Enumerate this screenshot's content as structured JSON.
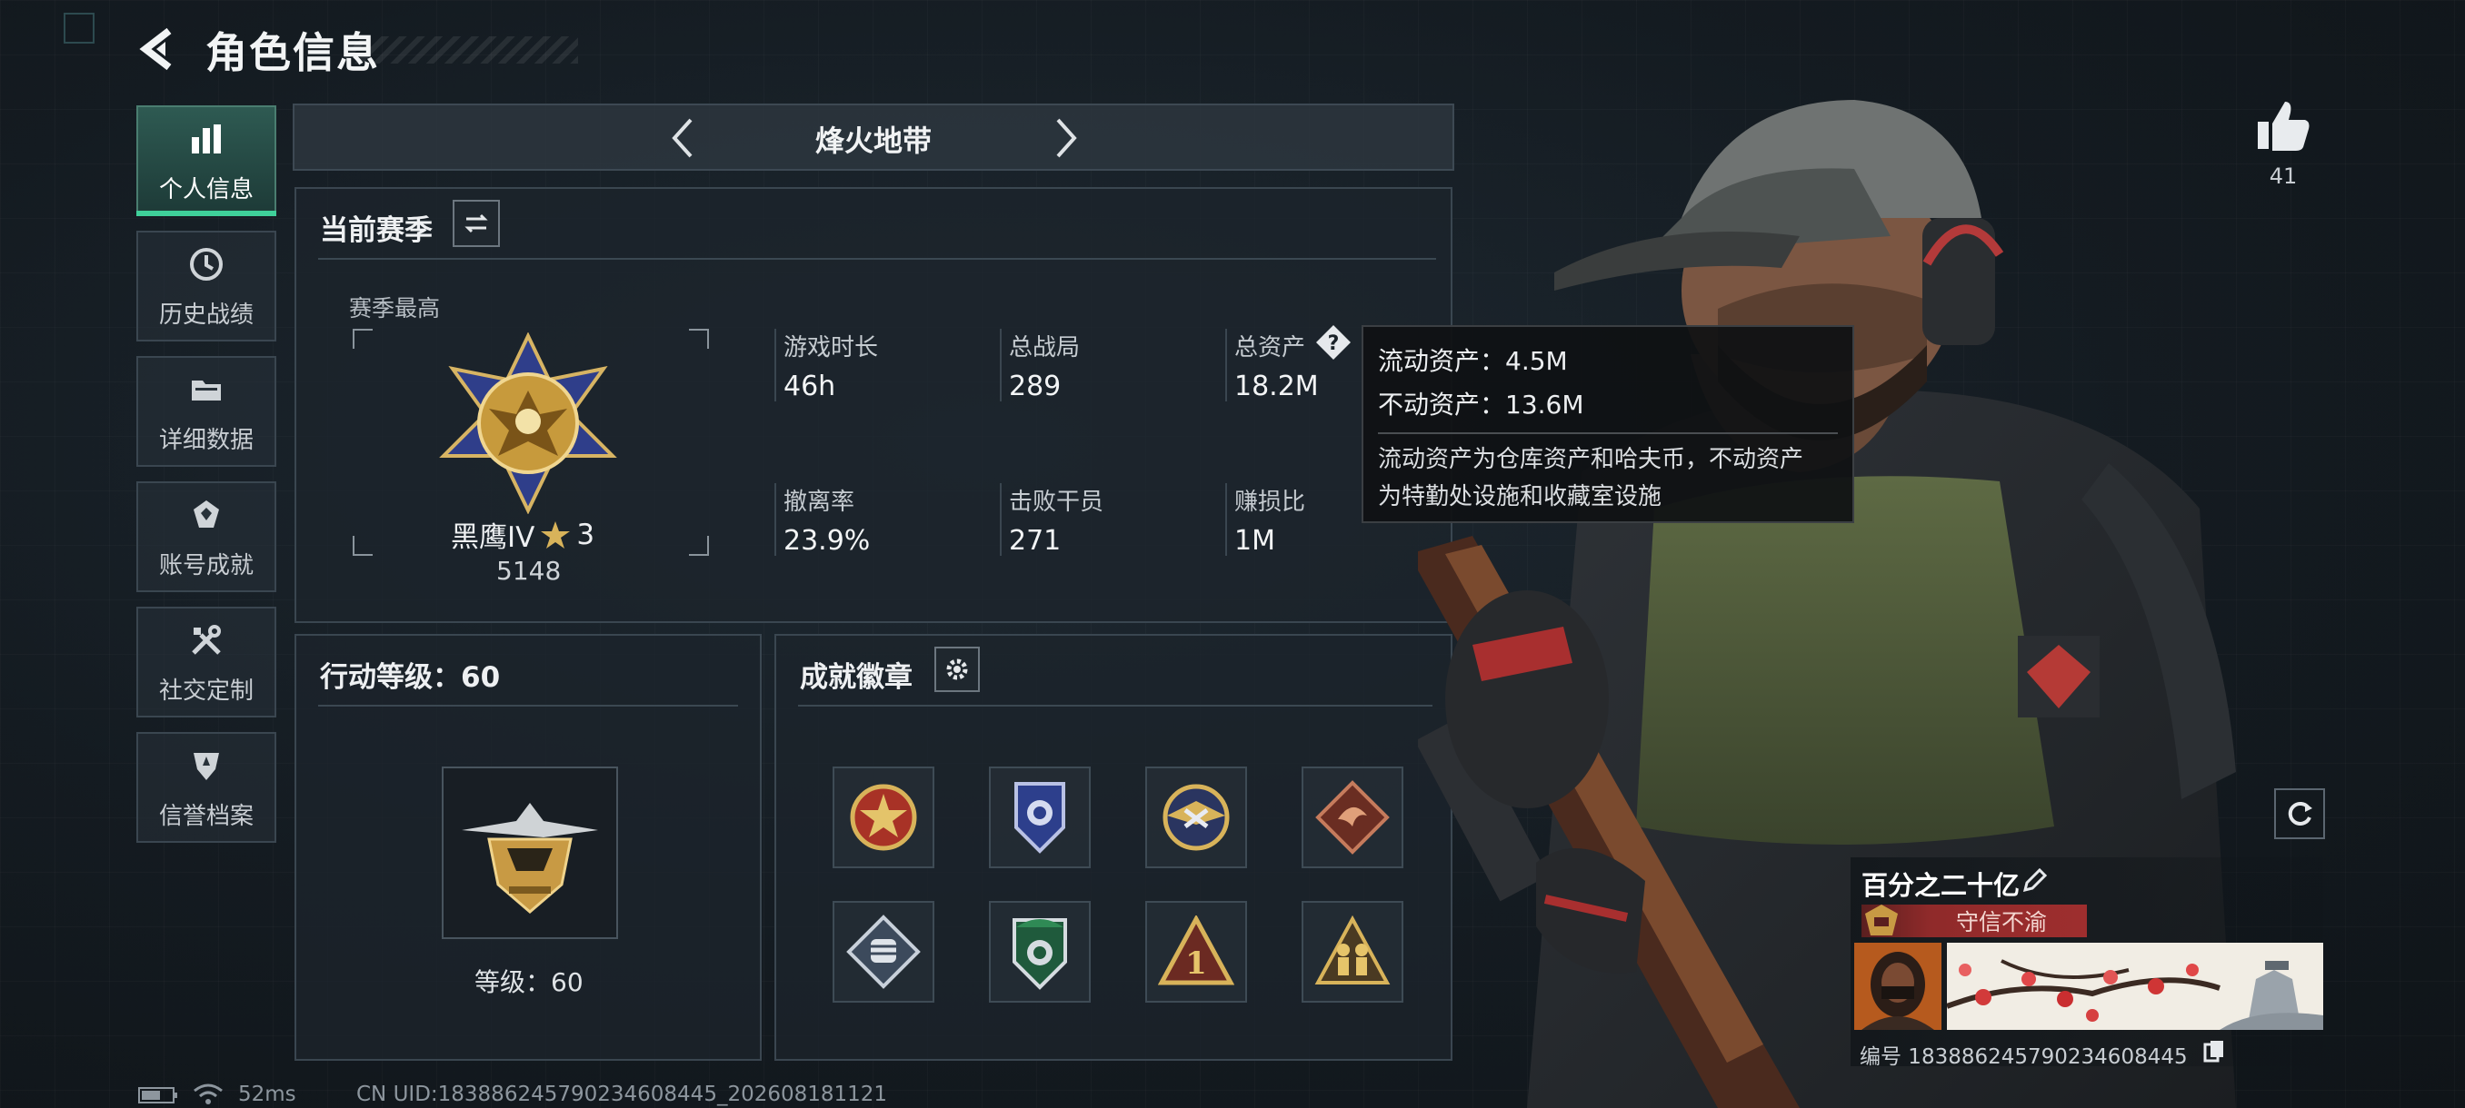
{
  "header": {
    "title": "角色信息"
  },
  "nav": {
    "items": [
      {
        "label": "个人信息",
        "icon": "bar-chart-icon",
        "active": true
      },
      {
        "label": "历史战绩",
        "icon": "history-icon"
      },
      {
        "label": "详细数据",
        "icon": "folder-icon"
      },
      {
        "label": "账号成就",
        "icon": "achievement-icon"
      },
      {
        "label": "社交定制",
        "icon": "tools-icon"
      },
      {
        "label": "信誉档案",
        "icon": "shield-icon"
      }
    ]
  },
  "mode": {
    "title": "烽火地带"
  },
  "season": {
    "title": "当前赛季",
    "best_label": "赛季最高",
    "rank_name": "黑鹰IV",
    "rank_stars": "3",
    "rank_score": "5148",
    "stats": [
      {
        "label": "游戏时长",
        "value": "46h"
      },
      {
        "label": "总战局",
        "value": "289"
      },
      {
        "label": "总资产",
        "value": "18.2M"
      },
      {
        "label": "撤离率",
        "value": "23.9%"
      },
      {
        "label": "击败干员",
        "value": "271"
      },
      {
        "label": "赚损比",
        "value": "1M"
      }
    ]
  },
  "tooltip": {
    "liquid": "流动资产：4.5M",
    "fixed": "不动资产：13.6M",
    "desc_line1": "流动资产为仓库资产和哈夫币，不动资产",
    "desc_line2": "为特勤处设施和收藏室设施"
  },
  "action_level": {
    "title": "行动等级：60",
    "caption": "等级：60"
  },
  "badges": {
    "title": "成就徽章",
    "items": [
      "star-badge-icon",
      "police-badge-icon",
      "eagle-badge-icon",
      "dragon-badge-icon",
      "fist-badge-icon",
      "green-shield-badge-icon",
      "number-one-badge-icon",
      "soldiers-badge-icon"
    ]
  },
  "social": {
    "likes": "41"
  },
  "player": {
    "name": "百分之二十亿",
    "trust_title": "守信不渝",
    "id_text": "编号 1838862457902346084​45"
  },
  "status": {
    "ping": "52ms",
    "uid": "CN UID:183886245790234608445_202608181121"
  },
  "colors": {
    "accent": "#3fd09a",
    "gold": "#d6a84a",
    "trust_red": "#9e2e2e"
  }
}
